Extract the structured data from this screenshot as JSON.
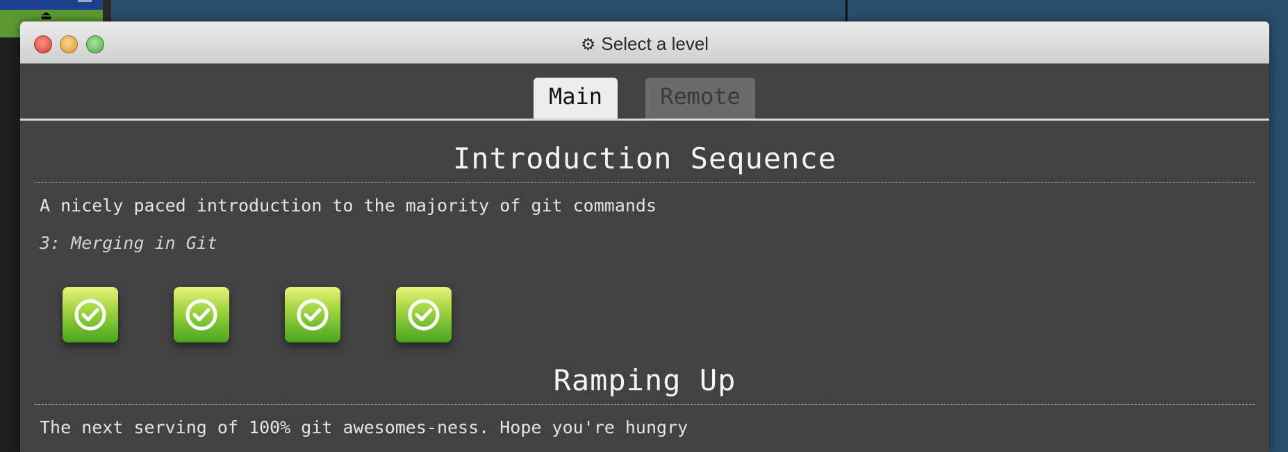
{
  "window": {
    "title": "Select a level",
    "title_icon": "gear-icon"
  },
  "tabs": [
    {
      "label": "Main",
      "selected": true
    },
    {
      "label": "Remote",
      "selected": false
    }
  ],
  "sequences": [
    {
      "title": "Introduction Sequence",
      "description": "A nicely paced introduction to the majority of git commands",
      "current_level": "3: Merging in Git",
      "levels": [
        {
          "status": "completed",
          "icon": "check-circle-icon"
        },
        {
          "status": "completed",
          "icon": "check-circle-icon"
        },
        {
          "status": "completed",
          "icon": "check-circle-icon"
        },
        {
          "status": "completed",
          "icon": "check-circle-icon"
        }
      ]
    },
    {
      "title": "Ramping Up",
      "description": "The next serving of 100% git awesomes-ness. Hope you're hungry"
    }
  ],
  "colors": {
    "level_completed": "#6cbf2a",
    "window_bg": "#424242",
    "desktop_bg": "#2a4d6a"
  }
}
